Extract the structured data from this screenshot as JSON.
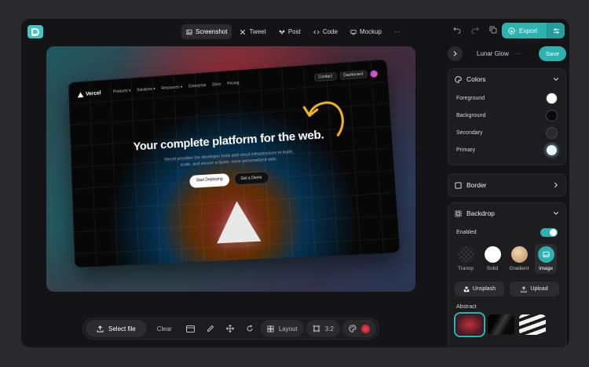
{
  "modes": [
    {
      "label": "Screenshot",
      "icon": "image-icon",
      "active": true
    },
    {
      "label": "Tweet",
      "icon": "x-logo-icon",
      "active": false
    },
    {
      "label": "Post",
      "icon": "butterfly-icon",
      "active": false
    },
    {
      "label": "Code",
      "icon": "code-icon",
      "active": false
    },
    {
      "label": "Mockup",
      "icon": "device-icon",
      "active": false
    }
  ],
  "header": {
    "export_label": "Export"
  },
  "canvas": {
    "site": {
      "brand": "Vercel",
      "nav": [
        "Products ▾",
        "Solutions ▾",
        "Resources ▾",
        "Enterprise",
        "Docs",
        "Pricing"
      ],
      "nav_right": [
        "Contact",
        "Dashboard"
      ],
      "headline": "Your complete platform for the web.",
      "subhead": "Vercel provides the developer tools and cloud infrastructure to build, scale, and secure a faster, more personalized web.",
      "cta_primary": "Start Deploying",
      "cta_secondary": "Get a Demo"
    }
  },
  "toolbar": {
    "select_file": "Select file",
    "clear": "Clear",
    "layout": "Layout",
    "ratio": "3:2"
  },
  "sidebar": {
    "preset_name": "Lunar Glow",
    "save_label": "Save",
    "colors": {
      "title": "Colors",
      "items": [
        {
          "label": "Foreground",
          "color": "#ffffff"
        },
        {
          "label": "Background",
          "color": "#0a0a0a"
        },
        {
          "label": "Secondary",
          "color": "#2a2a2d"
        },
        {
          "label": "Primary",
          "color": "#e8fbff"
        }
      ]
    },
    "border": {
      "title": "Border"
    },
    "backdrop": {
      "title": "Backdrop",
      "enabled_label": "Enabled",
      "options": [
        {
          "label": "Transp"
        },
        {
          "label": "Solid"
        },
        {
          "label": "Gradient"
        },
        {
          "label": "Image"
        }
      ],
      "unsplash_label": "Unsplash",
      "upload_label": "Upload",
      "abstract_label": "Abstract"
    }
  },
  "colors": {
    "accent": "#2bb3b1"
  }
}
